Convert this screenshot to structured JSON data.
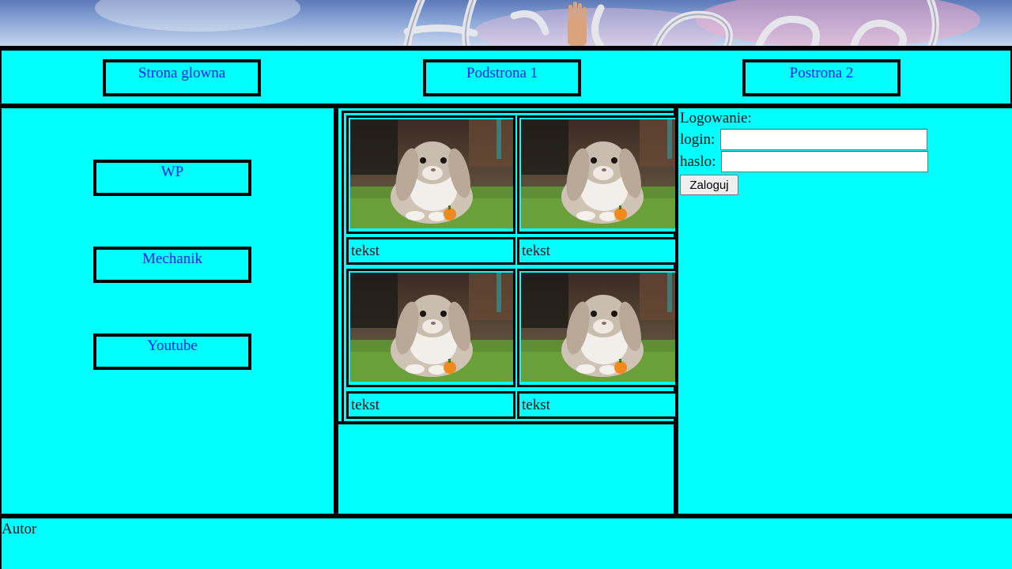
{
  "banner": {
    "logo_text": "Hu ang!"
  },
  "nav": {
    "items": [
      {
        "label": "Strona glowna"
      },
      {
        "label": "Podstrona 1"
      },
      {
        "label": "Postrona 2"
      }
    ]
  },
  "sidebar": {
    "links": [
      {
        "label": "WP"
      },
      {
        "label": "Mechanik"
      },
      {
        "label": "Youtube"
      }
    ]
  },
  "gallery": {
    "items": [
      {
        "image": "rabbit-photo",
        "caption": "tekst"
      },
      {
        "image": "rabbit-photo",
        "caption": "tekst"
      },
      {
        "image": "rabbit-photo",
        "caption": "tekst"
      },
      {
        "image": "rabbit-photo",
        "caption": "tekst"
      }
    ]
  },
  "login": {
    "heading": "Logowanie:",
    "login_label": "login:",
    "login_value": "",
    "password_label": "haslo:",
    "password_value": "",
    "submit_label": "Zaloguj"
  },
  "footer": {
    "text": "Autor"
  },
  "colors": {
    "background": "#00ffff",
    "link": "#1a1aff",
    "border": "#000000"
  }
}
